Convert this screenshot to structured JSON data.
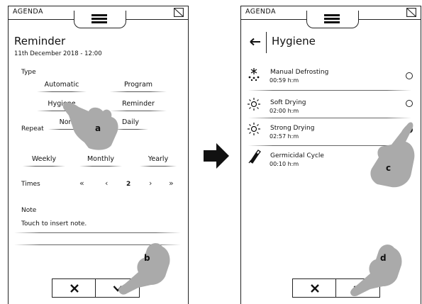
{
  "left_panel": {
    "app_title": "AGENDA",
    "title": "Reminder",
    "date": "11th December 2018 - 12:00",
    "type_label": "Type",
    "type_options": [
      "Automatic",
      "Program",
      "Hygiene",
      "Reminder"
    ],
    "repeat_label": "Repeat",
    "repeat_options": [
      "None",
      "Daily",
      "Weekly",
      "Monthly",
      "Yearly"
    ],
    "times_label": "Times",
    "times_value": "2",
    "note_label": "Note",
    "note_placeholder": "Touch to insert note."
  },
  "right_panel": {
    "app_title": "AGENDA",
    "title": "Hygiene",
    "programs": [
      {
        "name": "Manual Defrosting",
        "time": "00:59 h:m",
        "icon": "defrost-icon",
        "selected": false
      },
      {
        "name": "Soft Drying",
        "time": "02:00 h:m",
        "icon": "soft-drying-icon",
        "selected": false
      },
      {
        "name": "Strong Drying",
        "time": "02:57 h:m",
        "icon": "strong-drying-icon",
        "selected": true
      },
      {
        "name": "Germicidal Cycle",
        "time": "00:10 h:m",
        "icon": "germicidal-icon",
        "selected": false
      }
    ]
  },
  "callouts": {
    "a": "a",
    "b": "b",
    "c": "c",
    "d": "d"
  }
}
